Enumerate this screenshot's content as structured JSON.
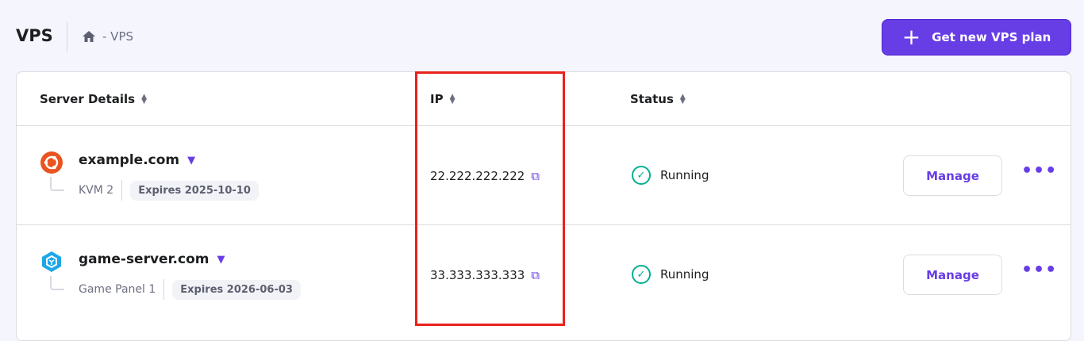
{
  "header": {
    "title": "VPS",
    "breadcrumb": "- VPS",
    "new_button": "Get new VPS plan"
  },
  "table": {
    "columns": [
      "Server Details",
      "IP",
      "Status"
    ],
    "rows": [
      {
        "name": "example.com",
        "plan": "KVM 2",
        "expires": "Expires 2025-10-10",
        "ip": "22.222.222.222",
        "status": "Running",
        "manage": "Manage",
        "os_icon": "ubuntu-icon"
      },
      {
        "name": "game-server.com",
        "plan": "Game Panel 1",
        "expires": "Expires 2026-06-03",
        "ip": "33.333.333.333",
        "status": "Running",
        "manage": "Manage",
        "os_icon": "game-panel-icon"
      }
    ]
  },
  "colors": {
    "accent": "#673de6",
    "success": "#00b090",
    "highlight": "#e8221b"
  }
}
